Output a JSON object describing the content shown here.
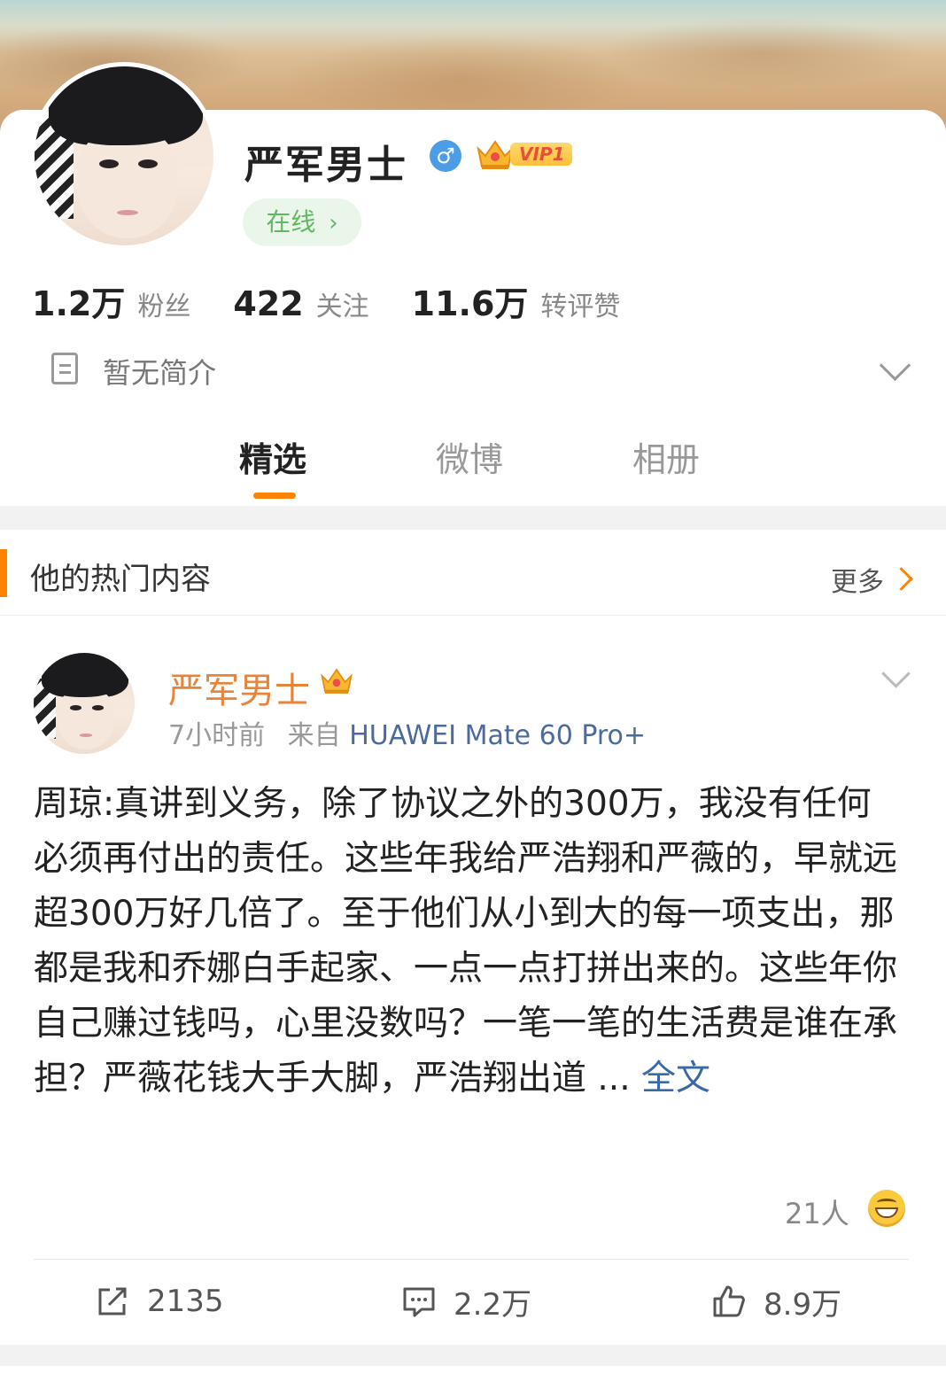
{
  "profile": {
    "username": "严军男士",
    "vip_label": "VIP1",
    "online_label": "在线",
    "stats": [
      {
        "value": "1.2万",
        "label": "粉丝"
      },
      {
        "value": "422",
        "label": "关注"
      },
      {
        "value": "11.6万",
        "label": "转评赞"
      }
    ],
    "bio": "暂无简介"
  },
  "tabs": [
    {
      "label": "精选",
      "active": true
    },
    {
      "label": "微博",
      "active": false
    },
    {
      "label": "相册",
      "active": false
    }
  ],
  "hot": {
    "title": "他的热门内容",
    "more_label": "更多"
  },
  "post": {
    "author": "严军男士",
    "time": "7小时前",
    "source_prefix": "来自",
    "source": "HUAWEI Mate 60 Pro+",
    "text": "周琼:真讲到义务，除了协议之外的300万，我没有任何必须再付出的责任。这些年我给严浩翔和严薇的，早就远超300万好几倍了。至于他们从小到大的每一项支出，那都是我和乔娜白手起家、一点一点打拼出来的。这些年你自己赚过钱吗，心里没数吗？一笔一笔的生活费是谁在承担？严薇花钱大手大脚，严浩翔出道 ...",
    "full_label": "全文",
    "reaction_count": "21人",
    "repost_count": "2135",
    "comment_count": "2.2万",
    "like_count": "8.9万"
  },
  "colors": {
    "accent": "#ff8200",
    "author_name": "#e8833a",
    "link": "#3a69a8",
    "online": "#62b862"
  }
}
